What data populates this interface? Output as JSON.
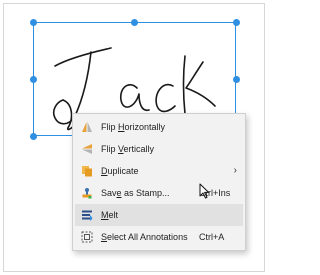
{
  "canvas": {
    "signature_text": "Jack",
    "selection_color": "#2f8fe3"
  },
  "context_menu": {
    "items": [
      {
        "pre": "Flip ",
        "key": "H",
        "post": "orizontally",
        "shortcut": "",
        "icon": "flip-horizontal-icon"
      },
      {
        "pre": "Flip ",
        "key": "V",
        "post": "ertically",
        "shortcut": "",
        "icon": "flip-vertical-icon"
      },
      {
        "pre": "",
        "key": "D",
        "post": "uplicate",
        "shortcut": "",
        "icon": "duplicate-icon",
        "submenu_arrow": "›"
      },
      {
        "pre": "Sav",
        "key": "e",
        "post": " as Stamp...",
        "shortcut": "Ctrl+Ins",
        "icon": "stamp-icon"
      },
      {
        "pre": "",
        "key": "M",
        "post": "elt",
        "shortcut": "",
        "icon": "melt-icon"
      },
      {
        "pre": "",
        "key": "S",
        "post": "elect All Annotations",
        "shortcut": "Ctrl+A",
        "icon": "select-all-icon"
      }
    ]
  }
}
